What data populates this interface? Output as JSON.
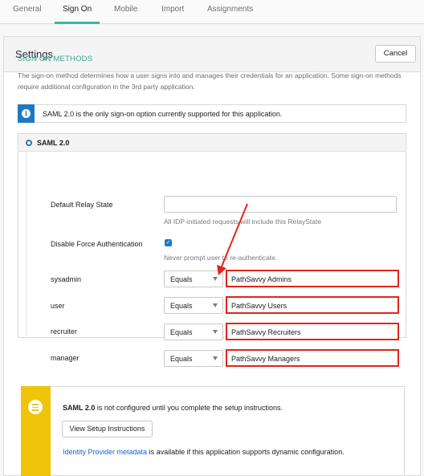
{
  "tabs": [
    {
      "label": "General"
    },
    {
      "label": "Sign On"
    },
    {
      "label": "Mobile"
    },
    {
      "label": "Import"
    },
    {
      "label": "Assignments"
    }
  ],
  "settings": {
    "title": "Settings",
    "cancel_label": "Cancel"
  },
  "sign_on_methods": {
    "heading": "SIGN ON METHODS",
    "description": "The sign-on method determines how a user signs into and manages their credentials for an application. Some sign-on methods require additional configuration in the 3rd party application.",
    "info_text": "SAML 2.0 is the only sign-on option currently supported for this application.",
    "info_icon": "info-icon"
  },
  "saml": {
    "label": "SAML 2.0",
    "relay_label": "Default Relay State",
    "relay_value": "",
    "relay_hint": "All IDP-initiated requests will include this RelayState",
    "force_auth_label": "Disable Force Authentication",
    "force_auth_checked": true,
    "force_auth_hint": "Never prompt user to re-authenticate.",
    "attributes": [
      {
        "name": "sysadmin",
        "operator": "Equals",
        "value": "PathSavvy Admins"
      },
      {
        "name": "user",
        "operator": "Equals",
        "value": "PathSavvy Users"
      },
      {
        "name": "recruiter",
        "operator": "Equals",
        "value": "PathSavvy Recruiters"
      },
      {
        "name": "manager",
        "operator": "Equals",
        "value": "PathSavvy Managers"
      }
    ]
  },
  "setup": {
    "bold": "SAML 2.0",
    "text": " is not configured until you complete the setup instructions.",
    "button_label": "View Setup Instructions",
    "link_text": "Identity Provider metadata",
    "link_suffix": " is available if this application supports dynamic configuration.",
    "icon": "list-icon"
  },
  "colors": {
    "accent": "#3db79a",
    "info_blue": "#1f78c6",
    "highlight_red": "#e1241c",
    "warning_yellow": "#efc40b",
    "link": "#1662dd"
  }
}
